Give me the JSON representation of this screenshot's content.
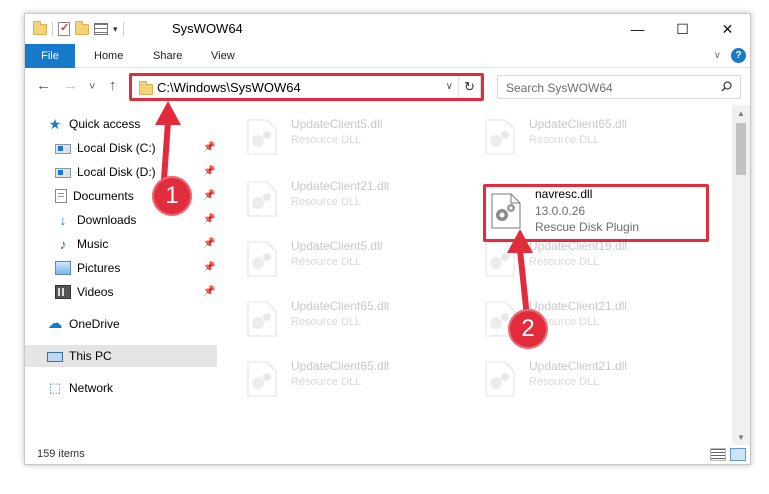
{
  "window": {
    "title": "SysWOW64"
  },
  "ribbon": {
    "tabs": [
      "File",
      "Home",
      "Share",
      "View"
    ],
    "help": "?"
  },
  "nav": {
    "back": "←",
    "forward": "→",
    "recent": "˅",
    "up": "↑",
    "address": "C:\\Windows\\SysWOW64",
    "refresh": "↻",
    "search_placeholder": "Search SysWOW64"
  },
  "sidebar": {
    "items": [
      {
        "label": "Quick access",
        "icon": "star-icon"
      },
      {
        "label": "Local Disk (C:)",
        "icon": "disk-icon",
        "pinned": true
      },
      {
        "label": "Local Disk (D:)",
        "icon": "disk-icon",
        "pinned": true
      },
      {
        "label": "Documents",
        "icon": "documents-icon",
        "pinned": true
      },
      {
        "label": "Downloads",
        "icon": "downloads-icon",
        "pinned": true
      },
      {
        "label": "Music",
        "icon": "music-icon",
        "pinned": true
      },
      {
        "label": "Pictures",
        "icon": "pictures-icon",
        "pinned": true
      },
      {
        "label": "Videos",
        "icon": "videos-icon",
        "pinned": true
      },
      {
        "label": "OneDrive",
        "icon": "onedrive-icon"
      },
      {
        "label": "This PC",
        "icon": "this-pc-icon",
        "selected": true
      },
      {
        "label": "Network",
        "icon": "network-icon"
      }
    ]
  },
  "files": [
    {
      "name": "UpdateClient5.dll",
      "desc": "Resource DLL"
    },
    {
      "name": "UpdateClient65.dll",
      "desc": "Resource DLL"
    },
    {
      "name": "UpdateClient21.dll",
      "desc": "Resource DLL"
    },
    {
      "name": "navresc.dll",
      "version": "13.0.0.26",
      "desc": "Rescue Disk Plugin",
      "highlighted": true
    },
    {
      "name": "UpdateClient5.dll",
      "desc": "Resource DLL"
    },
    {
      "name": "UpdateClient19.dll",
      "desc": "Resource DLL"
    },
    {
      "name": "UpdateClient65.dll",
      "desc": "Resource DLL"
    },
    {
      "name": "UpdateClient21.dll",
      "desc": "Resource DLL"
    },
    {
      "name": "UpdateClient65.dll",
      "desc": "Resource DLL"
    },
    {
      "name": "UpdateClient21.dll",
      "desc": "Resource DLL"
    }
  ],
  "status": {
    "item_count": "159 items"
  },
  "callouts": {
    "step1": "1",
    "step2": "2",
    "color": "#e02c3c"
  }
}
